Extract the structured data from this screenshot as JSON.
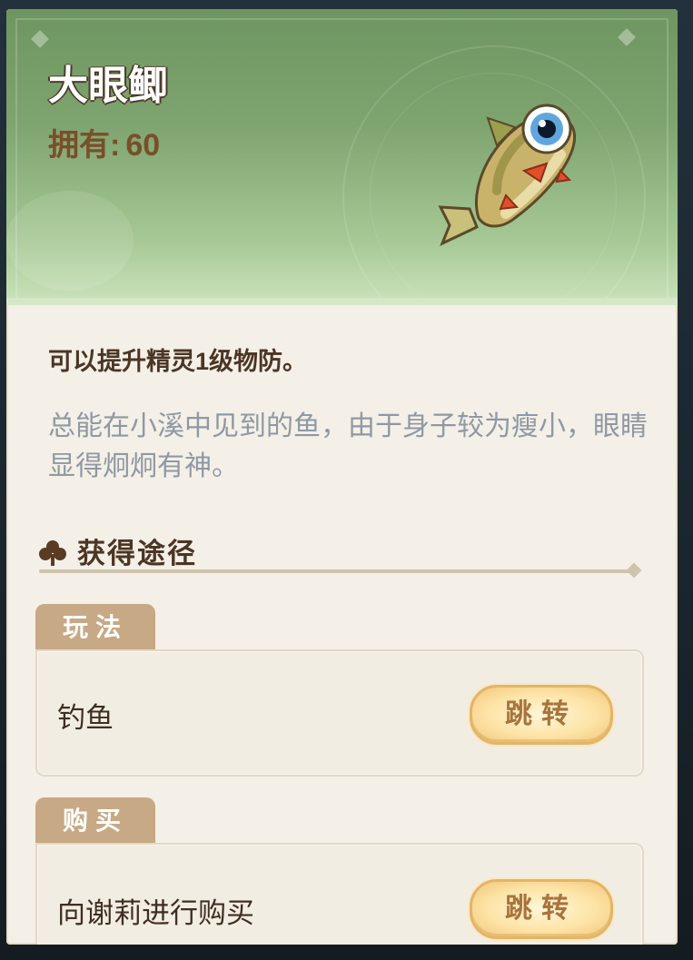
{
  "item": {
    "name": "大眼鲫",
    "owned_label": "拥有:",
    "owned_count": "60"
  },
  "description": {
    "effect": "可以提升精灵1级物防。",
    "flavor": "总能在小溪中见到的鱼，由于身子较为瘦小，眼睛显得炯炯有神。"
  },
  "obtain": {
    "title": "获得途径",
    "sections": [
      {
        "tab": "玩法",
        "label": "钓鱼",
        "button": "跳转"
      },
      {
        "tab": "购买",
        "label": "向谢莉进行购买",
        "button": "跳转"
      }
    ]
  },
  "colors": {
    "header_green": "#7ea46f",
    "tab_tan": "#c7a985",
    "button_gold": "#fde4a7",
    "text_brown": "#4b3524",
    "flavor_gray": "#8f98a4"
  }
}
